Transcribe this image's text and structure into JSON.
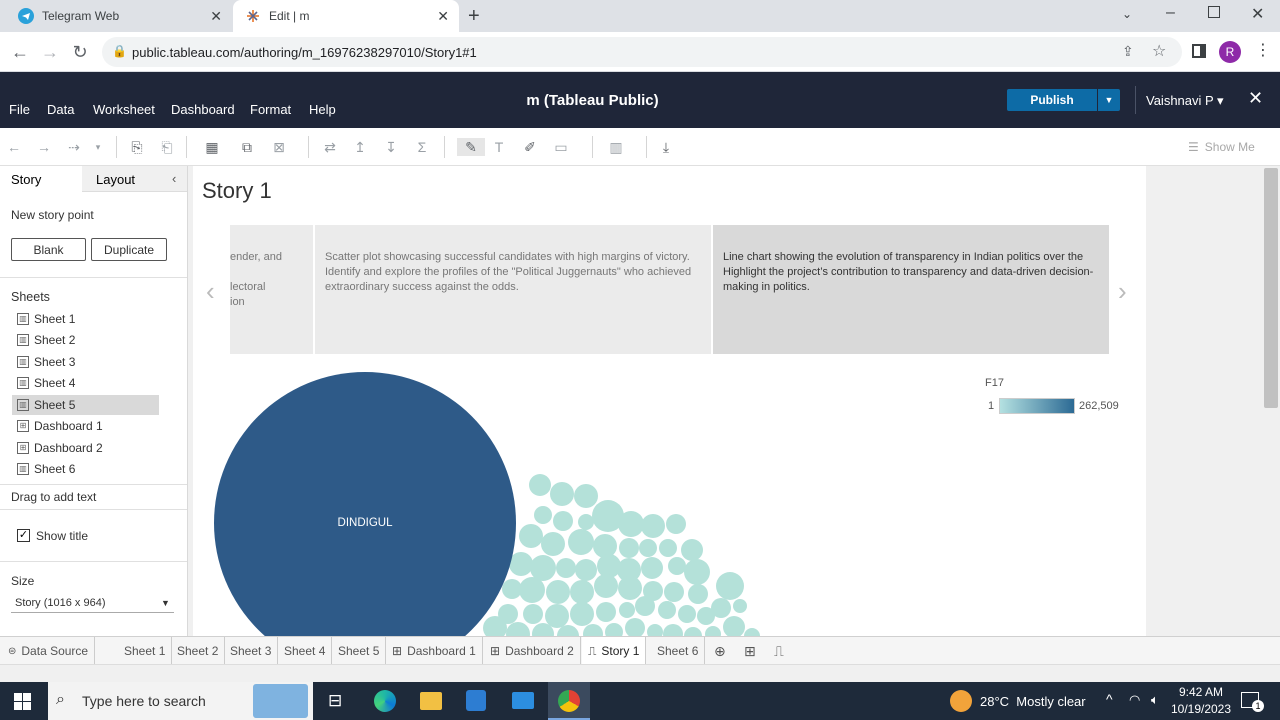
{
  "browser": {
    "tabs": [
      {
        "title": "Telegram Web",
        "active": false
      },
      {
        "title": "Edit | m",
        "active": true
      }
    ],
    "url": "public.tableau.com/authoring/m_16976238297010/Story1#1",
    "profile_initial": "R"
  },
  "app": {
    "title": "m (Tableau Public)",
    "menu": [
      "File",
      "Data",
      "Worksheet",
      "Dashboard",
      "Format",
      "Help"
    ],
    "publish_label": "Publish",
    "user": "Vaishnavi P ▾",
    "show_me": "Show Me"
  },
  "left_panel": {
    "tabs": [
      "Story",
      "Layout"
    ],
    "new_story_point": "New story point",
    "blank_button": "Blank",
    "duplicate_button": "Duplicate",
    "sheets_header": "Sheets",
    "sheets": [
      "Sheet 1",
      "Sheet 2",
      "Sheet 3",
      "Sheet 4",
      "Sheet 5",
      "Dashboard 1",
      "Dashboard 2",
      "Sheet 6"
    ],
    "selected_sheet": "Sheet 5",
    "drag_text": "Drag to add text",
    "show_title_label": "Show title",
    "show_title_checked": true,
    "size_header": "Size",
    "size_value": "Story (1016 x 964)"
  },
  "story": {
    "title": "Story 1",
    "points": [
      {
        "text": "ender, and\n\nlectoral\nion"
      },
      {
        "text": "Scatter plot showcasing successful candidates with high margins of victory.\n Identify and explore the profiles of the \"Political Juggernauts\" who achieved extraordinary success against the odds."
      },
      {
        "text": " Line chart showing the evolution of transparency in Indian politics over the  Highlight the project’s contribution to transparency and data-driven decision-making in politics."
      }
    ],
    "legend": {
      "title": "F17",
      "min": "1",
      "max": "262,509"
    },
    "bubble_label": "DINDIGUL",
    "colors": {
      "big_bubble": "#2e5a88",
      "small_bubble": "#b4e1d9"
    }
  },
  "bottom_tabs": [
    "Data Source",
    "Sheet 1",
    "Sheet 2",
    "Sheet 3",
    "Sheet 4",
    "Sheet 5",
    "Dashboard 1",
    "Dashboard 2",
    "Story 1",
    "Sheet 6"
  ],
  "active_bottom_tab": "Story 1",
  "taskbar": {
    "search_placeholder": "Type here to search",
    "weather": "28°C  Mostly clear",
    "time": "9:42 AM",
    "date": "10/19/2023",
    "notification_count": "1"
  }
}
